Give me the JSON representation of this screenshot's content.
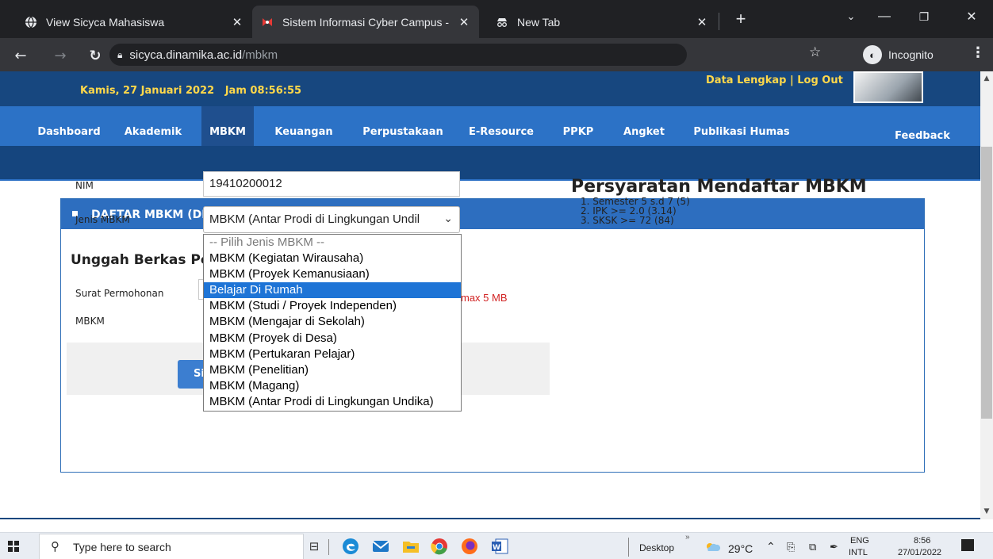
{
  "browser": {
    "tabs": [
      {
        "title": "View Sicyca Mahasiswa",
        "icon": "globe-icon",
        "active": false
      },
      {
        "title": "Sistem Informasi Cyber Campus -",
        "icon": "sicyca-logo-icon",
        "active": true
      },
      {
        "title": "New Tab",
        "icon": "incognito-icon",
        "active": false
      }
    ],
    "url_host": "sicyca.dinamika.ac.id",
    "url_path": "/mbkm",
    "incognito_label": "Incognito"
  },
  "header": {
    "date_time": "Kamis, 27 Januari 2022   Jam 08:56:55",
    "account_links": "Data Lengkap | Log Out"
  },
  "menu": {
    "items": [
      "Dashboard",
      "Akademik",
      "MBKM",
      "Keuangan",
      "Perpustakaan",
      "E-Resource",
      "PPKP",
      "Angket",
      "Publikasi Humas"
    ],
    "active": "MBKM",
    "feedback": "Feedback"
  },
  "panel": {
    "title": "DAFTAR MBKM (DEV)",
    "nim_label": "NIM",
    "nim_value": "19410200012",
    "jenis_label": "Jenis MBKM",
    "jenis_value": "MBKM (Antar Prodi di Lingkungan Undil",
    "upload_title": "Unggah Berkas Per",
    "surat_label": "Surat Permohonan",
    "mbkm_label": "MBKM",
    "max_size": "max 5 MB",
    "submit_label": "Si"
  },
  "requirements": {
    "title": "Persyaratan Mendaftar MBKM",
    "items": [
      "1. Semester 5 s.d 7 (5)",
      "2. IPK >= 2.0 (3.14)",
      "3. SKSK >= 72 (84)"
    ]
  },
  "dropdown": {
    "options": [
      "-- Pilih Jenis MBKM --",
      "MBKM (Kegiatan Wirausaha)",
      "MBKM (Proyek Kemanusiaan)",
      "Belajar Di Rumah",
      "MBKM (Studi / Proyek Independen)",
      "MBKM (Mengajar di Sekolah)",
      "MBKM (Proyek di Desa)",
      "MBKM (Pertukaran Pelajar)",
      "MBKM (Penelitian)",
      "MBKM (Magang)",
      "MBKM (Antar Prodi di Lingkungan Undika)"
    ],
    "highlighted": "Belajar Di Rumah"
  },
  "taskbar": {
    "search_placeholder": "Type here to search",
    "desktop_label": "Desktop",
    "weather": "29°C",
    "lang_top": "ENG",
    "lang_bottom": "INTL",
    "time": "8:56",
    "date": "27/01/2022"
  },
  "colors": {
    "header_dark": "#17477f",
    "menu_blue": "#2c72c6",
    "panel_head": "#2d6ebf",
    "accent_yellow": "#ffd84a",
    "error_red": "#d12222",
    "dropdown_highlight": "#1e74d6"
  }
}
